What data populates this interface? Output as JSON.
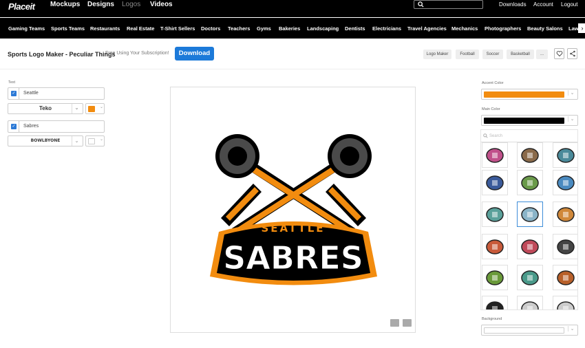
{
  "brand": "Placeit",
  "topnav": {
    "items": [
      "Mockups",
      "Designs",
      "Logos",
      "Videos"
    ],
    "right": [
      "Downloads",
      "Account",
      "Logout"
    ]
  },
  "categories": [
    "Gaming Teams",
    "Sports Teams",
    "Restaurants",
    "Real Estate",
    "T-Shirt Sellers",
    "Doctors",
    "Teachers",
    "Gyms",
    "Bakeries",
    "Landscaping",
    "Dentists",
    "Electricians",
    "Travel Agencies",
    "Mechanics",
    "Photographers",
    "Beauty Salons",
    "Law"
  ],
  "header": {
    "title": "Sports Logo Maker - Peculiar Things",
    "note": "Free Using Your Subscription!",
    "download": "Download",
    "tags": [
      "Logo Maker",
      "Football",
      "Soccer",
      "Basketball",
      "..."
    ]
  },
  "left": {
    "section_label": "Text",
    "line1": {
      "value": "Seattle",
      "font": "Teko",
      "color": "#f28c0f"
    },
    "line2": {
      "value": "Sabres",
      "font": "BOWLBYONE",
      "color": "#ffffff"
    }
  },
  "logo": {
    "line1": "SEATTLE",
    "line2": "SABRES"
  },
  "right": {
    "accent_label": "Accent Color",
    "accent_color": "#f28c0f",
    "main_label": "Main Color",
    "main_color": "#000000",
    "search_placeholder": "Search",
    "background_label": "Background",
    "background_color": "#ffffff"
  },
  "gallery": [
    "sign-icon",
    "vintage-truck-icon",
    "pistons-icon",
    "cannon-icon",
    "jet-icon",
    "rocket-icon",
    "saw-blade-icon",
    "crossed-sabres-icon",
    "burger-icon",
    "hotdog-icon",
    "hand-drill-icon",
    "top-hat-man-icon",
    "pickle-icon",
    "trowel-icon",
    "squirrel-icon",
    "crossed-tools-icon",
    "",
    ""
  ]
}
